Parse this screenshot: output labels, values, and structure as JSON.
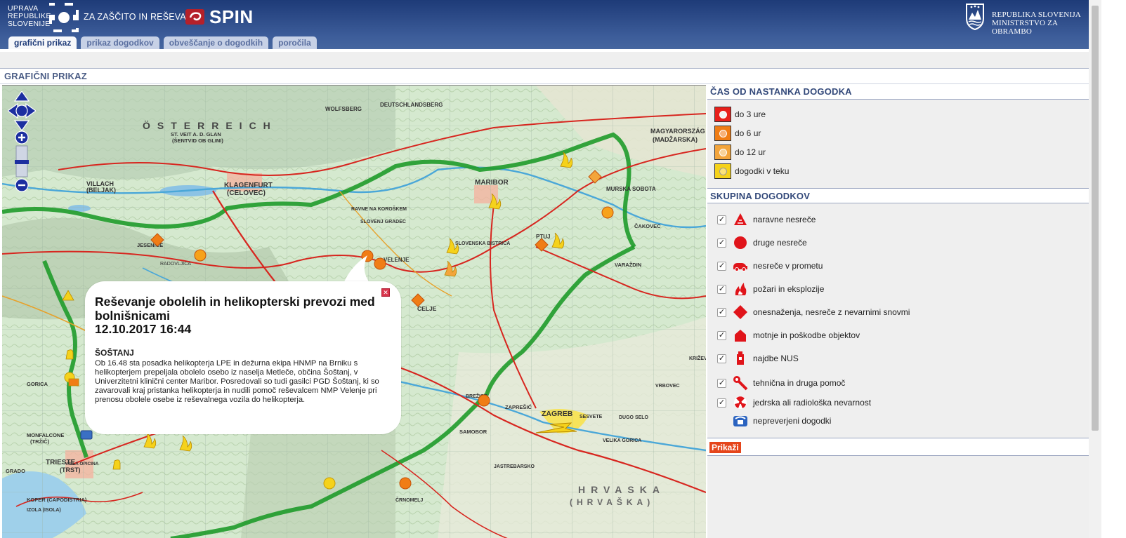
{
  "header": {
    "urs_lines": [
      "UPRAVA",
      "REPUBLIKE",
      "SLOVENIJE"
    ],
    "agency": "ZA ZAŠČITO IN REŠEVANJE",
    "app_name": "SPIN",
    "ministry_lines": [
      "REPUBLIKA SLOVENIJA",
      "MINISTRSTVO ZA OBRAMBO"
    ]
  },
  "tabs": [
    {
      "label": "grafični prikaz",
      "active": true
    },
    {
      "label": "prikaz dogodkov",
      "active": false
    },
    {
      "label": "obveščanje o dogodkih",
      "active": false
    },
    {
      "label": "poročila",
      "active": false
    }
  ],
  "page_title": "GRAFIČNI PRIKAZ",
  "popup": {
    "title": "Reševanje obolelih in helikopterski prevozi med bolnišnicami",
    "datetime": "12.10.2017 16:44",
    "location": "ŠOŠTANJ",
    "text": "Ob 16.48 sta posadka helikopterja LPE in dežurna ekipa HNMP na Brniku s helikopterjem prepeljala obolelo osebo iz naselja Metleče, občina Šoštanj, v Univerzitetni klinični center Maribor. Posredovali so tudi gasilci PGD Šoštanj, ki so zavarovali kraj pristanka helikopterja in nudili pomoč reševalcem NMP Velenje pri prenosu obolele osebe iz reševalnega vozila do helikopterja."
  },
  "map_labels": [
    "ÖSTERREICH",
    "KLAGENFURT",
    "(CELOVEC)",
    "VILLACH",
    "(BELJAK)",
    "WOLFSBERG",
    "DEUTSCHLANDSBERG",
    "ST. VEIT A. D. GLAN",
    "(ŠENTVID OB GLINI)",
    "MARIBOR",
    "MURSKA SOBOTA",
    "MAGYARORSZÁG",
    "(MADŽARSKA)",
    "PTUJ",
    "ČAKOVEC",
    "VARAŽDIN",
    "JESENICE",
    "RADOVLJICA",
    "VELENJE",
    "CELJE",
    "SLOVENSKA BISTRICA",
    "ZAGREB",
    "SAMOBOR",
    "ZAPREŠIĆ",
    "SESVETE",
    "KRIŽEVCI",
    "HRVASKA",
    "(HRVAŠKA)",
    "TRIESTE",
    "(TRST)",
    "KOPER (CAPODISTRIA)",
    "MONFALCONE",
    "(TRŽIČ)",
    "GORICA",
    "GRADO",
    "VILLA OPICINA",
    "VELIKA GORICA",
    "DUGO SELO",
    "RAVNE NA KOROŠKEM",
    "SLOVENJ GRADEC",
    "BREŽICE",
    "ČRNOMELJ",
    "IZOLA (ISOLA)",
    "JASTREBARSKO",
    "VRBOVEC"
  ],
  "legend_time": {
    "header": "ČAS OD NASTANKA DOGODKA",
    "items": [
      {
        "label": "do 3 ure",
        "color": "#e8201c"
      },
      {
        "label": "do 6 ur",
        "color": "#f07d16"
      },
      {
        "label": "do 12 ur",
        "color": "#f3a53c"
      },
      {
        "label": "dogodki v teku",
        "color": "#f5d21b"
      }
    ]
  },
  "legend_groups": {
    "header": "SKUPINA DOGODKOV",
    "items": [
      {
        "label": "naravne nesreče",
        "icon": "natural-disaster-icon",
        "checked": true
      },
      {
        "label": "druge nesreče",
        "icon": "other-accidents-icon",
        "checked": true
      },
      {
        "label": "nesreče v prometu",
        "icon": "traffic-accident-icon",
        "checked": true
      },
      {
        "label": "požari in eksplozije",
        "icon": "fire-explosion-icon",
        "checked": true
      },
      {
        "label": "onesnaženja, nesreče z nevarnimi snovmi",
        "icon": "hazardous-substances-icon",
        "checked": true
      },
      {
        "label": "motnje in poškodbe objektov",
        "icon": "building-damage-icon",
        "checked": true
      },
      {
        "label": "najdbe NUS",
        "icon": "unexploded-ordnance-icon",
        "checked": true
      },
      {
        "label": "tehnična in druga pomoč",
        "icon": "technical-help-icon",
        "checked": true
      },
      {
        "label": "jedrska ali radiološka nevarnost",
        "icon": "radiation-icon",
        "checked": true
      },
      {
        "label": "nepreverjeni dogodki",
        "icon": "unverified-phone-icon",
        "checked": false
      }
    ]
  },
  "show_button": "Prikaži",
  "check_mark": "✓",
  "colors": {
    "header_dark": "#1e3b78",
    "group_icon_red": "#e0141a",
    "event_orange": "#f07d16",
    "event_yellow": "#f5d21b",
    "border_green": "#1f9b2a",
    "road_red": "#d7261f"
  }
}
